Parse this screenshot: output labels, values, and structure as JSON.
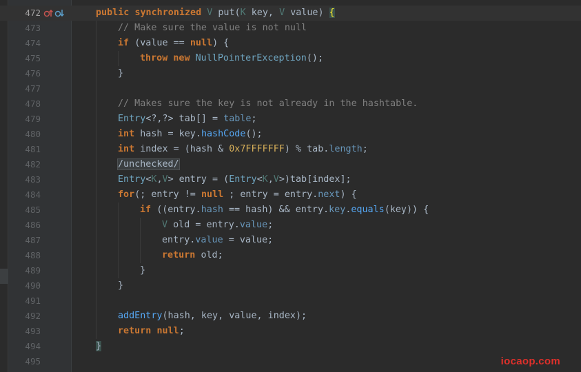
{
  "editor": {
    "lines": [
      {
        "number": "472",
        "current": true,
        "indent": 0,
        "icons": [
          "override-up-icon",
          "implemented-down-icon"
        ],
        "tokens": [
          [
            "kw",
            "public "
          ],
          [
            "kw",
            "synchronized "
          ],
          [
            "tp",
            "V "
          ],
          [
            "plain",
            "put("
          ],
          [
            "tp",
            "K "
          ],
          [
            "plain",
            "key, "
          ],
          [
            "tp",
            "V "
          ],
          [
            "plain",
            "value) "
          ],
          [
            "hl-brace",
            "{"
          ]
        ]
      },
      {
        "number": "473",
        "indent": 1,
        "tokens": [
          [
            "cm",
            "// Make sure the value is not null"
          ]
        ]
      },
      {
        "number": "474",
        "indent": 1,
        "tokens": [
          [
            "kw",
            "if "
          ],
          [
            "plain",
            "(value == "
          ],
          [
            "kw",
            "null"
          ],
          [
            "plain",
            ") {"
          ]
        ]
      },
      {
        "number": "475",
        "indent": 2,
        "tokens": [
          [
            "kw",
            "throw "
          ],
          [
            "kw",
            "new "
          ],
          [
            "cls",
            "NullPointerException"
          ],
          [
            "plain",
            "();"
          ]
        ]
      },
      {
        "number": "476",
        "indent": 1,
        "tokens": [
          [
            "plain",
            "}"
          ]
        ]
      },
      {
        "number": "477",
        "indent": 0,
        "tokens": []
      },
      {
        "number": "478",
        "indent": 1,
        "tokens": [
          [
            "cm",
            "// Makes sure the key is not already in the hashtable."
          ]
        ]
      },
      {
        "number": "479",
        "indent": 1,
        "tokens": [
          [
            "cls",
            "Entry"
          ],
          [
            "plain",
            "<?,?> tab[] = "
          ],
          [
            "fld",
            "table"
          ],
          [
            "plain",
            ";"
          ]
        ]
      },
      {
        "number": "480",
        "indent": 1,
        "tokens": [
          [
            "kw",
            "int "
          ],
          [
            "plain",
            "hash = key."
          ],
          [
            "fn",
            "hashCode"
          ],
          [
            "plain",
            "();"
          ]
        ]
      },
      {
        "number": "481",
        "indent": 1,
        "tokens": [
          [
            "kw",
            "int "
          ],
          [
            "plain",
            "index = (hash & "
          ],
          [
            "num",
            "0x7FFFFFFF"
          ],
          [
            "plain",
            ") % tab."
          ],
          [
            "fld",
            "length"
          ],
          [
            "plain",
            ";"
          ]
        ]
      },
      {
        "number": "482",
        "indent": 1,
        "tokens": [
          [
            "hl-box",
            "/unchecked/"
          ]
        ]
      },
      {
        "number": "483",
        "indent": 1,
        "tokens": [
          [
            "cls",
            "Entry"
          ],
          [
            "plain",
            "<"
          ],
          [
            "tp",
            "K"
          ],
          [
            "plain",
            ","
          ],
          [
            "tp",
            "V"
          ],
          [
            "plain",
            "> entry = ("
          ],
          [
            "cls",
            "Entry"
          ],
          [
            "plain",
            "<"
          ],
          [
            "tp",
            "K"
          ],
          [
            "plain",
            ","
          ],
          [
            "tp",
            "V"
          ],
          [
            "plain",
            ">)tab[index];"
          ]
        ]
      },
      {
        "number": "484",
        "indent": 1,
        "tokens": [
          [
            "kw",
            "for"
          ],
          [
            "plain",
            "(; entry != "
          ],
          [
            "kw",
            "null "
          ],
          [
            "plain",
            "; entry = entry."
          ],
          [
            "fld",
            "next"
          ],
          [
            "plain",
            ") {"
          ]
        ]
      },
      {
        "number": "485",
        "indent": 2,
        "tokens": [
          [
            "kw",
            "if "
          ],
          [
            "plain",
            "((entry."
          ],
          [
            "fld",
            "hash"
          ],
          [
            "plain",
            " == hash) && entry."
          ],
          [
            "fld",
            "key"
          ],
          [
            "plain",
            "."
          ],
          [
            "fn",
            "equals"
          ],
          [
            "plain",
            "(key)) {"
          ]
        ]
      },
      {
        "number": "486",
        "indent": 3,
        "tokens": [
          [
            "tp",
            "V "
          ],
          [
            "plain",
            "old = entry."
          ],
          [
            "fld",
            "value"
          ],
          [
            "plain",
            ";"
          ]
        ]
      },
      {
        "number": "487",
        "indent": 3,
        "tokens": [
          [
            "plain",
            "entry."
          ],
          [
            "fld",
            "value"
          ],
          [
            "plain",
            " = value;"
          ]
        ]
      },
      {
        "number": "488",
        "indent": 3,
        "tokens": [
          [
            "kw",
            "return "
          ],
          [
            "plain",
            "old;"
          ]
        ]
      },
      {
        "number": "489",
        "indent": 2,
        "tokens": [
          [
            "plain",
            "}"
          ]
        ]
      },
      {
        "number": "490",
        "indent": 1,
        "tokens": [
          [
            "plain",
            "}"
          ]
        ]
      },
      {
        "number": "491",
        "indent": 0,
        "tokens": []
      },
      {
        "number": "492",
        "indent": 1,
        "tokens": [
          [
            "fn",
            "addEntry"
          ],
          [
            "plain",
            "(hash, key, value, index);"
          ]
        ]
      },
      {
        "number": "493",
        "indent": 1,
        "tokens": [
          [
            "kw",
            "return "
          ],
          [
            "kw",
            "null"
          ],
          [
            "plain",
            ";"
          ]
        ]
      },
      {
        "number": "494",
        "indent": 0,
        "tokens": [
          [
            "hl-brace2",
            "}"
          ]
        ]
      },
      {
        "number": "495",
        "indent": 0,
        "tokens": []
      }
    ]
  },
  "watermark": "iocaop.com",
  "colors": {
    "background": "#2b2b2b",
    "gutter": "#313335",
    "keyword": "#cc7832",
    "comment": "#808080",
    "field": "#6897bb",
    "method": "#56a8f5",
    "type_param": "#507874",
    "number": "#d8b05a",
    "watermark": "#e0302b"
  }
}
